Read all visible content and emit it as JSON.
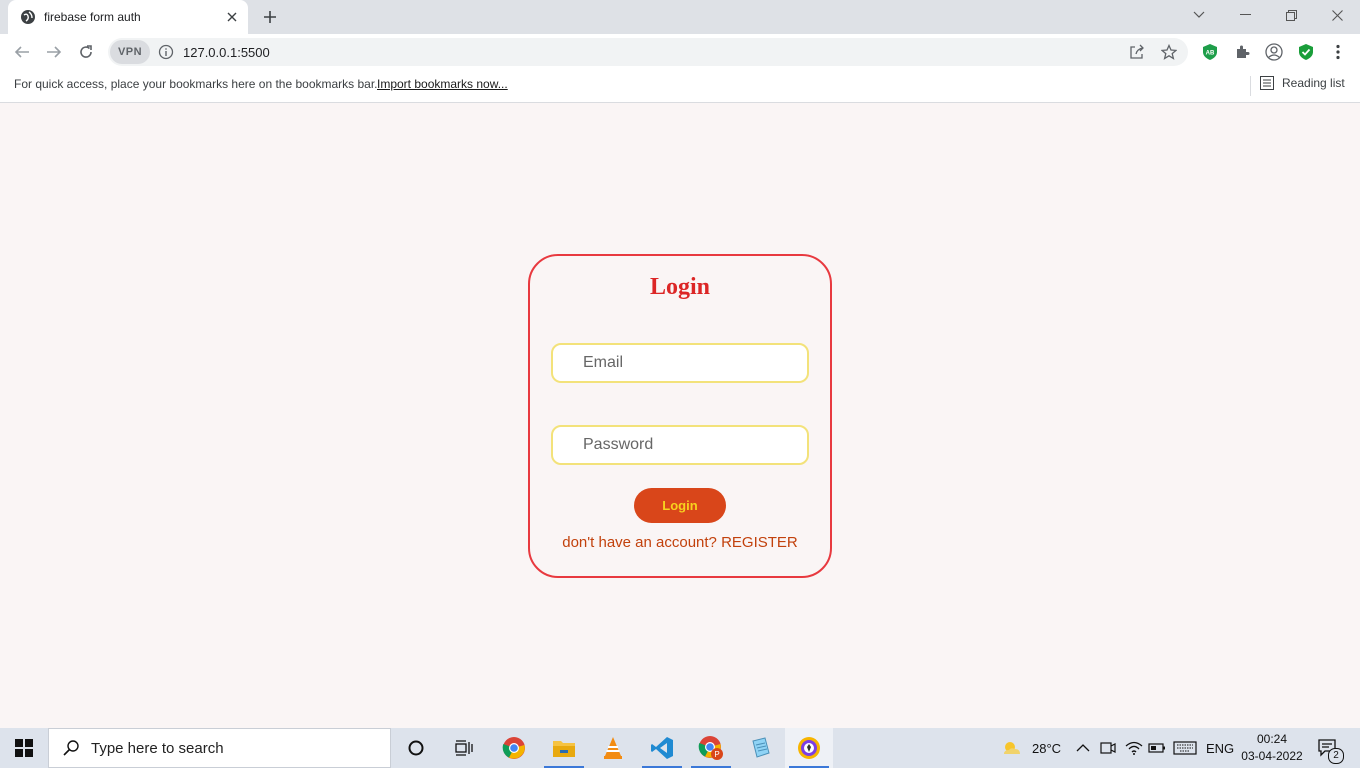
{
  "browser": {
    "tab_title": "firebase form auth",
    "url": "127.0.0.1:5500",
    "vpn_label": "VPN",
    "bookmarks_hint": "For quick access, place your bookmarks here on the bookmarks bar.",
    "import_bookmarks": "Import bookmarks now...",
    "reading_list": "Reading list"
  },
  "login": {
    "title": "Login",
    "email_placeholder": "Email",
    "password_placeholder": "Password",
    "button": "Login",
    "register_text": "don't have an account? REGISTER"
  },
  "taskbar": {
    "search_placeholder": "Type here to search",
    "temperature": "28°C",
    "language": "ENG",
    "time": "00:24",
    "date": "03-04-2022",
    "notification_count": "2"
  },
  "colors": {
    "card_border": "#e8393f",
    "title": "#dc2626",
    "field_border": "#f3e27a",
    "button_bg": "#d9461a",
    "button_text": "#f7d21e",
    "register_text": "#c2410c",
    "page_bg": "#faf5f5"
  }
}
